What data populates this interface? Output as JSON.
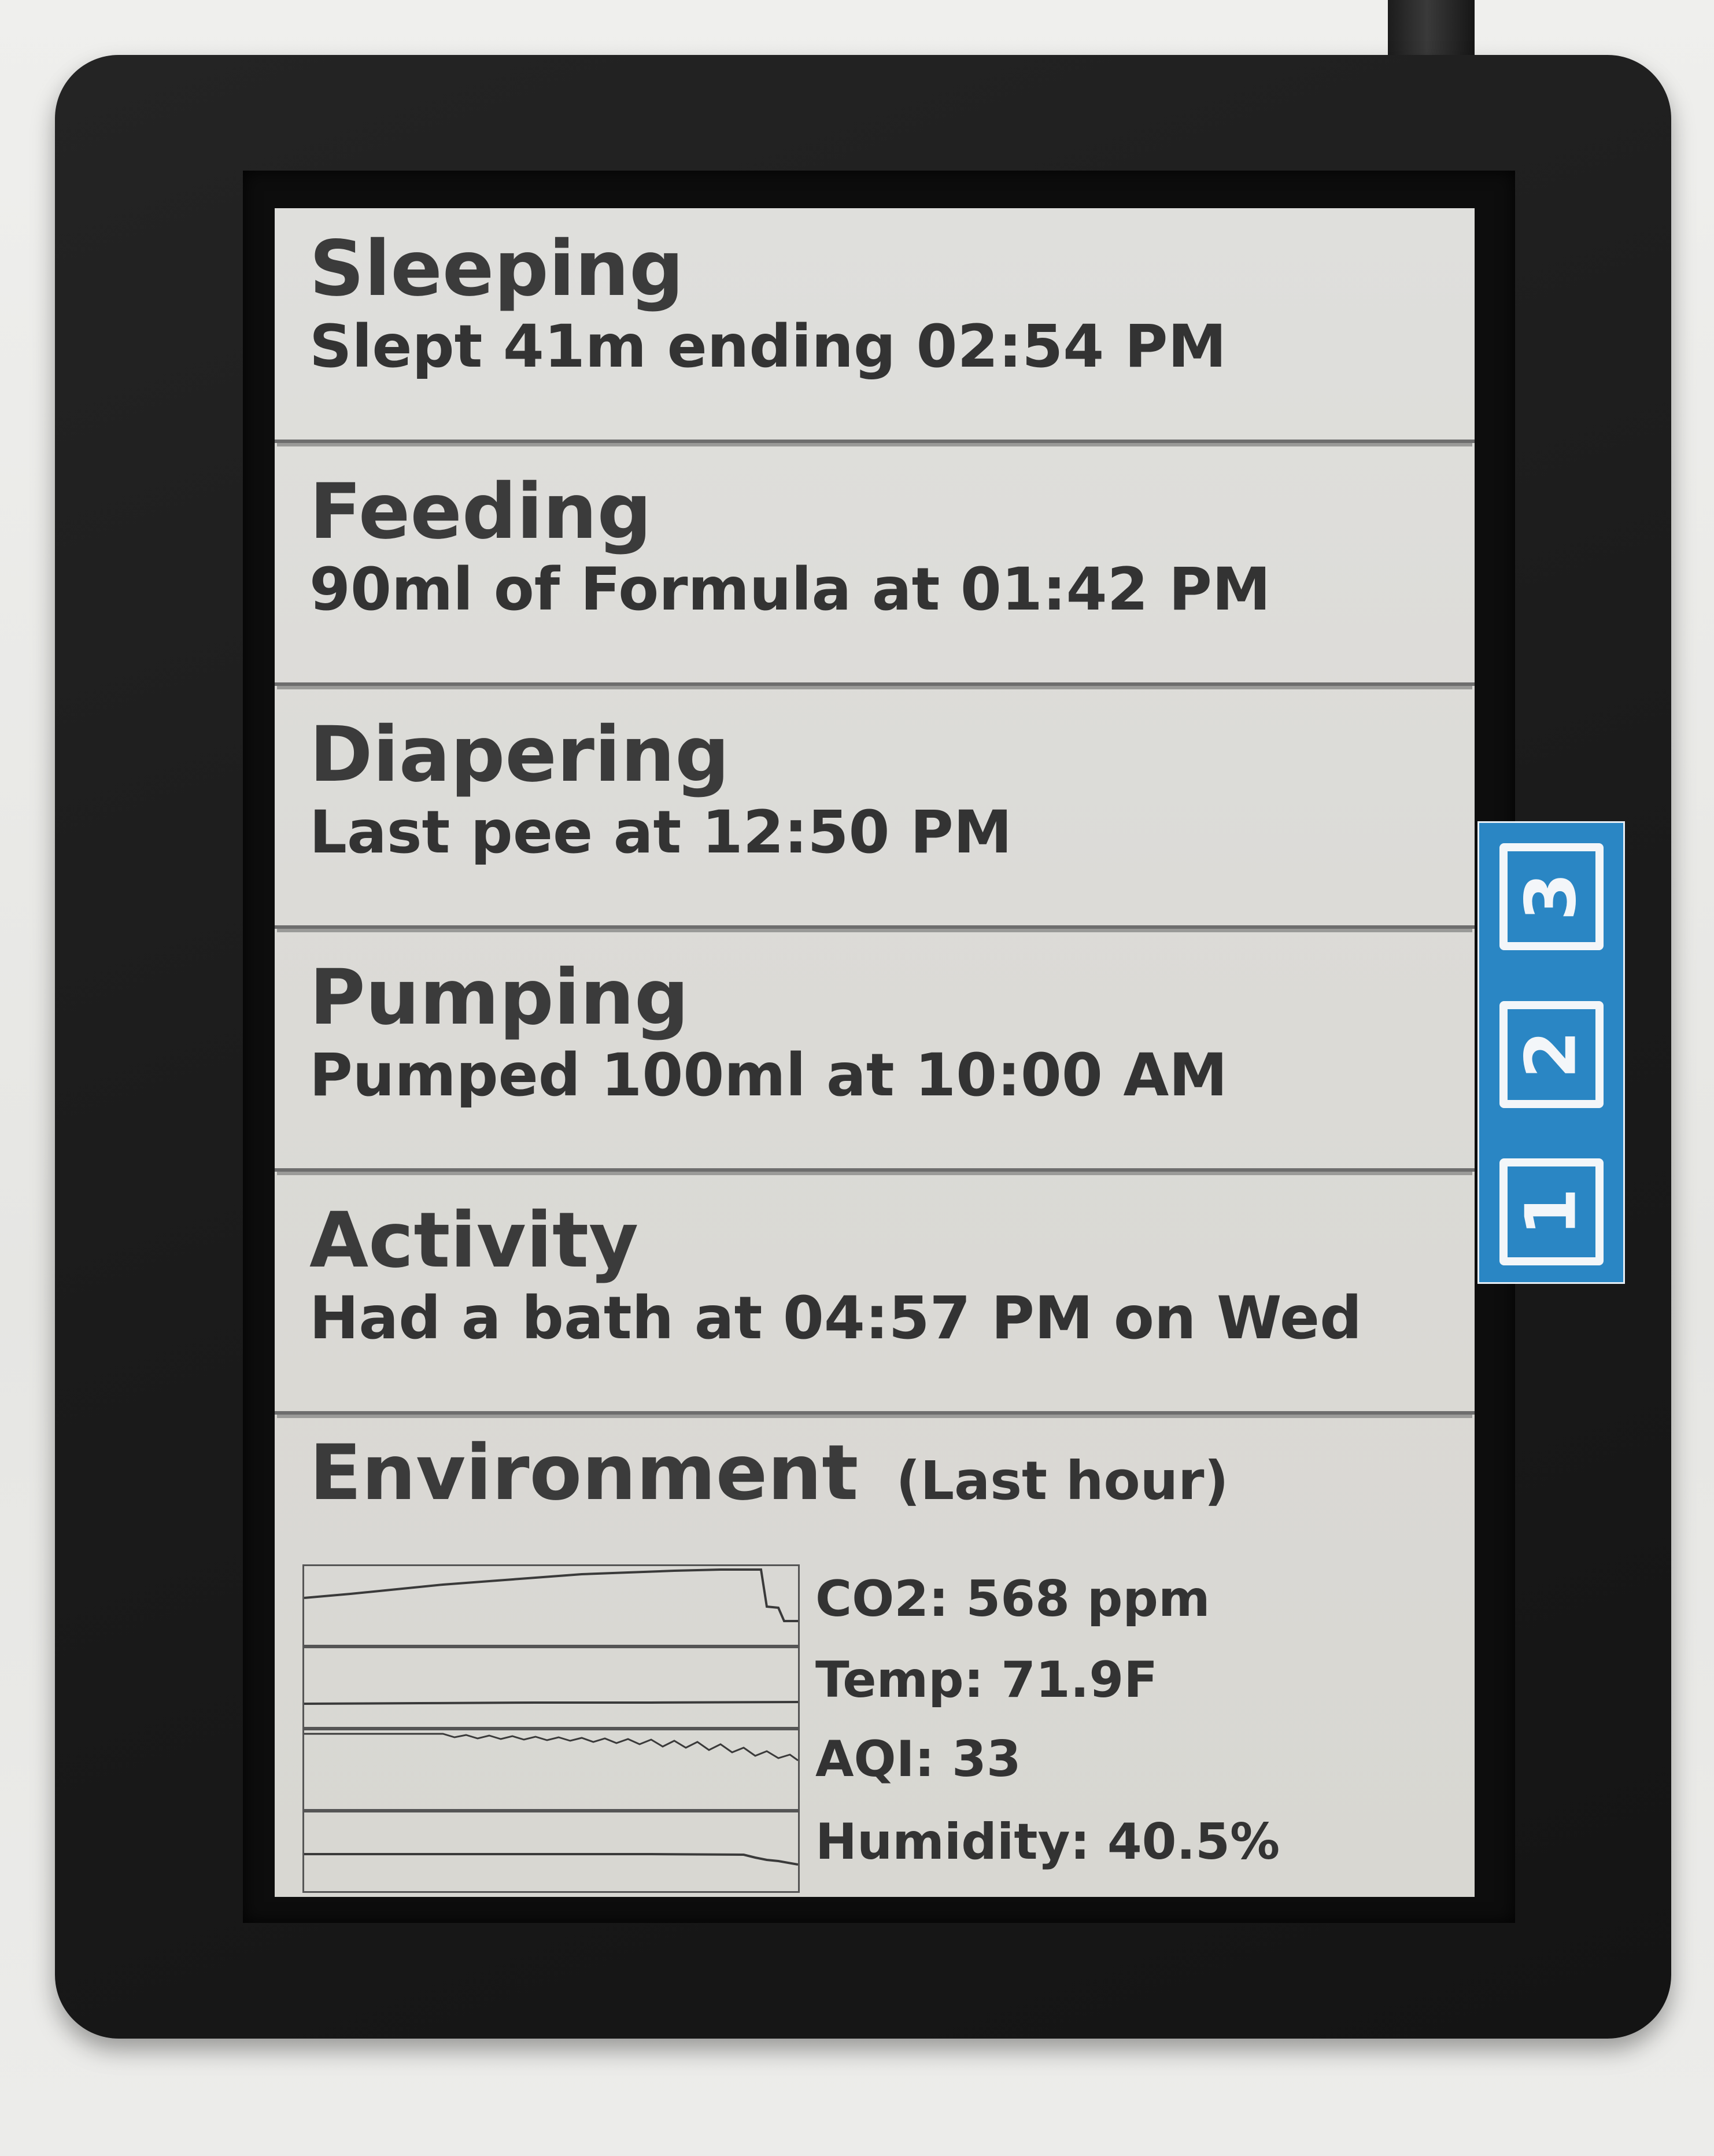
{
  "sections": [
    {
      "title": "Sleeping",
      "detail": "Slept 41m ending 02:54 PM"
    },
    {
      "title": "Feeding",
      "detail": "90ml of Formula at 01:42 PM"
    },
    {
      "title": "Diapering",
      "detail": "Last pee at 12:50 PM"
    },
    {
      "title": "Pumping",
      "detail": "Pumped 100ml at 10:00 AM"
    },
    {
      "title": "Activity",
      "detail": "Had a bath at 04:57 PM on Wed"
    }
  ],
  "environment": {
    "title": "Environment",
    "subtitle": "(Last hour)",
    "metrics": [
      {
        "label": "CO2: 568 ppm"
      },
      {
        "label": "Temp: 71.9F"
      },
      {
        "label": "AQI: 33"
      },
      {
        "label": "Humidity: 40.5%"
      }
    ]
  },
  "buttons": [
    {
      "label": "3"
    },
    {
      "label": "2"
    },
    {
      "label": "1"
    }
  ],
  "colors": {
    "device": "#1b1b1b",
    "screen": "#dbdad6",
    "ink": "#333333",
    "button_panel": "#2a86c4"
  }
}
